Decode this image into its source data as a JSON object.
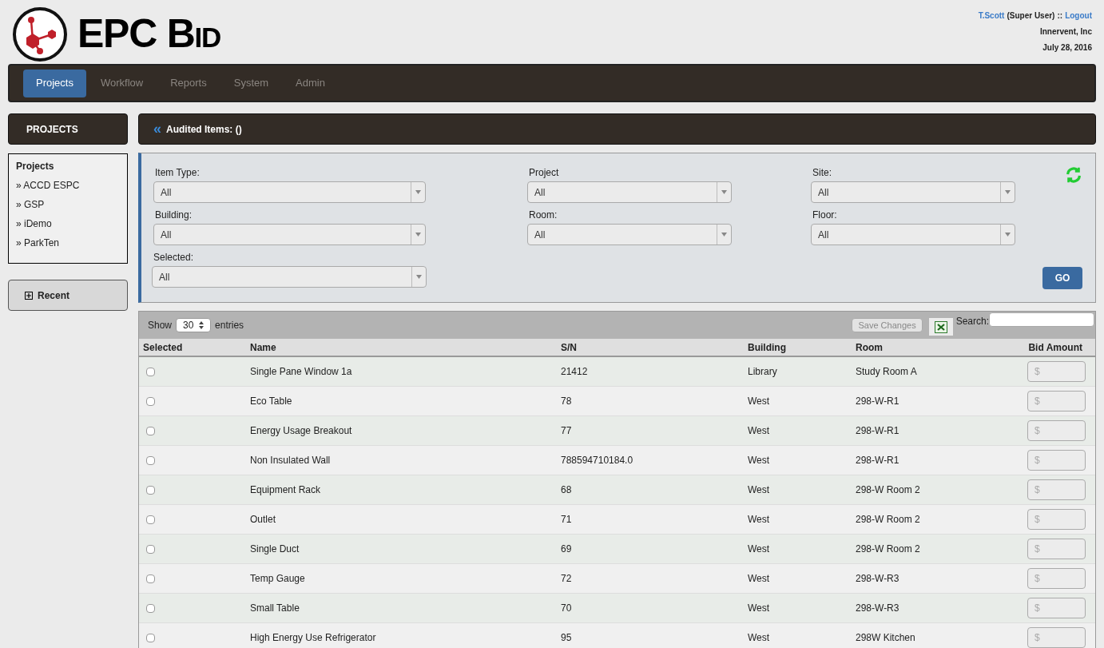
{
  "brand": {
    "name": "EPC Bid"
  },
  "user": {
    "name": "T.Scott",
    "role": "(Super User)",
    "separator": "::",
    "logout": "Logout",
    "company": "Innervent, Inc",
    "date": "July 28, 2016"
  },
  "nav": [
    {
      "label": "Projects",
      "selected": true
    },
    {
      "label": "Workflow",
      "selected": false
    },
    {
      "label": "Reports",
      "selected": false
    },
    {
      "label": "System",
      "selected": false
    },
    {
      "label": "Admin",
      "selected": false
    }
  ],
  "sidebar": {
    "title": "PROJECTS",
    "list_title": "Projects",
    "items": [
      "» ACCD ESPC",
      "» GSP",
      "» iDemo",
      "» ParkTen"
    ],
    "recent": {
      "label": "Recent",
      "expanded": false
    }
  },
  "panel": {
    "back": "«",
    "title": "Audited Items: ()"
  },
  "filters": [
    {
      "label": "Item Type:",
      "value": "All"
    },
    {
      "label": "Project",
      "value": "All"
    },
    {
      "label": "Site:",
      "value": "All"
    },
    {
      "label": "Building:",
      "value": "All"
    },
    {
      "label": "Room:",
      "value": "All"
    },
    {
      "label": "Floor:",
      "value": "All"
    },
    {
      "label": "Selected:",
      "value": "All"
    }
  ],
  "go_button": "GO",
  "table": {
    "show": "Show",
    "page_size": "30",
    "entries": "entries",
    "save": "Save Changes",
    "search_label": "Search:",
    "columns": [
      "Selected",
      "Name",
      "S/N",
      "Building",
      "Room",
      "Bid Amount"
    ],
    "rows": [
      {
        "checked": false,
        "name": "Single Pane Window 1a",
        "sn": "21412",
        "building": "Library",
        "room": "Study Room A",
        "bid_placeholder": "$"
      },
      {
        "checked": false,
        "name": "Eco Table",
        "sn": "78",
        "building": "West",
        "room": "298-W-R1",
        "bid_placeholder": "$"
      },
      {
        "checked": false,
        "name": "Energy Usage Breakout",
        "sn": "77",
        "building": "West",
        "room": "298-W-R1",
        "bid_placeholder": "$"
      },
      {
        "checked": false,
        "name": "Non Insulated Wall",
        "sn": "788594710184.0",
        "building": "West",
        "room": "298-W-R1",
        "bid_placeholder": "$"
      },
      {
        "checked": false,
        "name": "Equipment Rack",
        "sn": "68",
        "building": "West",
        "room": "298-W Room 2",
        "bid_placeholder": "$"
      },
      {
        "checked": false,
        "name": "Outlet",
        "sn": "71",
        "building": "West",
        "room": "298-W Room 2",
        "bid_placeholder": "$"
      },
      {
        "checked": false,
        "name": "Single Duct",
        "sn": "69",
        "building": "West",
        "room": "298-W Room 2",
        "bid_placeholder": "$"
      },
      {
        "checked": false,
        "name": "Temp Gauge",
        "sn": "72",
        "building": "West",
        "room": "298-W-R3",
        "bid_placeholder": "$"
      },
      {
        "checked": false,
        "name": "Small Table",
        "sn": "70",
        "building": "West",
        "room": "298-W-R3",
        "bid_placeholder": "$"
      },
      {
        "checked": false,
        "name": "High Energy Use Refrigerator",
        "sn": "95",
        "building": "West",
        "room": "298W Kitchen",
        "bid_placeholder": "$"
      }
    ]
  }
}
